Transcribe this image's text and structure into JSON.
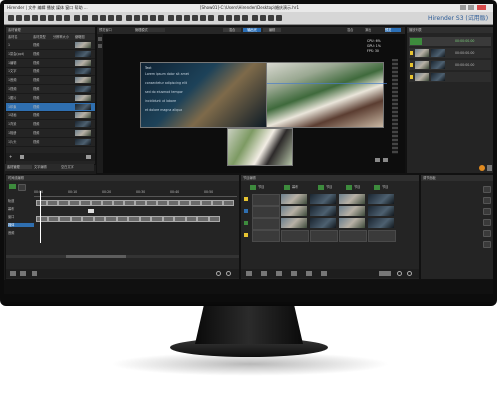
{
  "app": {
    "title": "Hirender S3 (试用版)",
    "window_title": "Hirender | 文件 编辑 播放 媒体 窗口 帮助 ...",
    "file_path": "[Show01]-C:\\Users\\Hirender\\Desktop\\婚庆演示.hr1"
  },
  "media_panel": {
    "title": "素材管理",
    "columns": [
      "素材名",
      "素材类型",
      "分辨率大小",
      "缩略图"
    ],
    "rows": [
      "1",
      "1宴会(ppt)",
      "1编辑",
      "1文字",
      "1音频",
      "1视频",
      "1图片",
      "1印象",
      "1动画",
      "1背景",
      "1相册",
      "1片头"
    ],
    "row_type": "视频",
    "tabs": [
      "素材管理",
      "文字编辑",
      "空白文字"
    ]
  },
  "preview": {
    "title": "预览窗口",
    "mode": "管理模式",
    "tabs": [
      "混合",
      "输出光",
      "编辑"
    ],
    "right_tabs": [
      "混合",
      "演出",
      "预览"
    ],
    "overlay_title": "Text",
    "overlay_lines": [
      "Lorem ipsum dolor sit amet",
      "consectetur adipiscing elit",
      "sed do eiusmod tempor",
      "incididunt ut labore",
      "et dolore magna aliqua"
    ],
    "status": [
      "CPU: 6%",
      "GPU: 1%",
      "FPS: 30"
    ]
  },
  "playlist": {
    "title": "播放列表",
    "items": [
      "00:00:00.00",
      "00:00:00.00",
      "00:00:00.00"
    ]
  },
  "timeline": {
    "title": "时间线编辑",
    "tracks": [
      "轨道",
      "幕布",
      "窗口",
      "媒体",
      "音频"
    ],
    "times": [
      "00:00",
      "00:10",
      "00:20",
      "00:30",
      "00:40",
      "00:50"
    ]
  },
  "stage": {
    "title": "节目编辑",
    "cols": [
      "节目",
      "幕布",
      "节目",
      "节目",
      "节目"
    ]
  },
  "props": {
    "title": "调节面板"
  },
  "colors": {
    "accent_blue": "#2f6fb0",
    "green": "#3d8b3d",
    "yellow": "#e7c431"
  }
}
